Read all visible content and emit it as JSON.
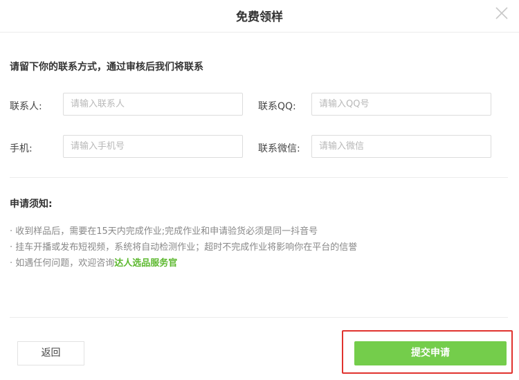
{
  "dialog": {
    "title": "免费领样",
    "close_icon": "close-icon"
  },
  "form": {
    "intro": "请留下你的联系方式，通过审核后我们将联系",
    "fields": [
      {
        "label": "联系人:",
        "placeholder": "请输入联系人",
        "value": ""
      },
      {
        "label": "联系QQ:",
        "placeholder": "请输入QQ号",
        "value": ""
      },
      {
        "label": "手机:",
        "placeholder": "请输入手机号",
        "value": ""
      },
      {
        "label": "联系微信:",
        "placeholder": "请输入微信",
        "value": ""
      }
    ]
  },
  "notice": {
    "title": "申请须知:",
    "items": [
      "· 收到样品后，需要在15天内完成作业;完成作业和申请验货必须是同一抖音号",
      "· 挂车开播或发布短视频，系统将自动检测作业；超时不完成作业将影响你在平台的信誉"
    ],
    "contact_prefix": "· 如遇任何问题，欢迎咨询",
    "contact_link": "达人选品服务官"
  },
  "footer": {
    "back_label": "返回",
    "submit_label": "提交申请"
  },
  "colors": {
    "accent_green": "#74cd4b",
    "link_green": "#5cb82e",
    "highlight_red": "#e0322e"
  }
}
